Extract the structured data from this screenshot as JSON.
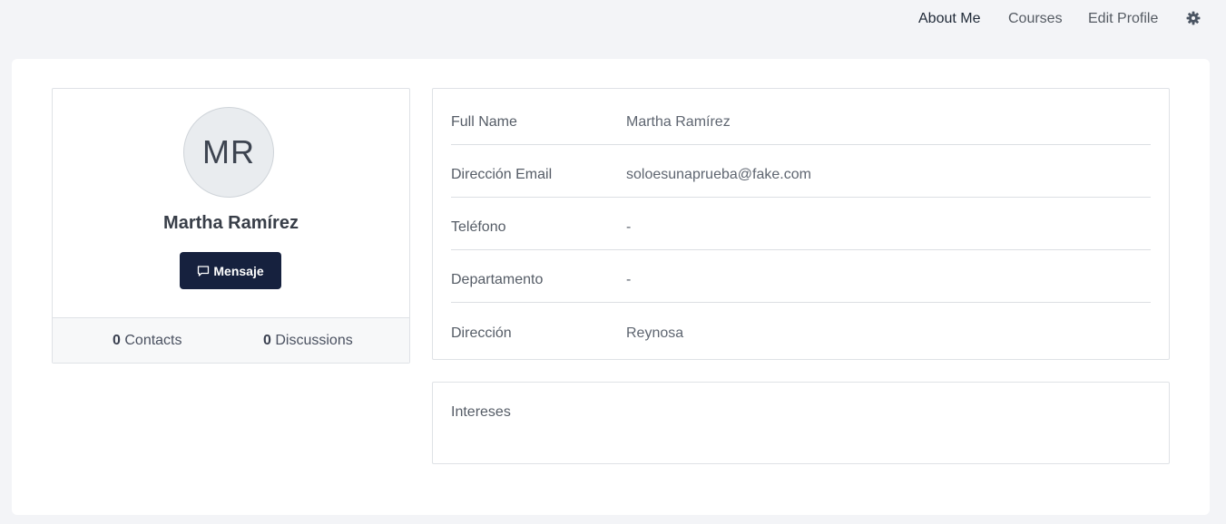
{
  "nav": {
    "about": "About Me",
    "courses": "Courses",
    "edit_profile": "Edit Profile",
    "settings_icon": "gear-icon"
  },
  "profile": {
    "initials": "MR",
    "name": "Martha Ramírez",
    "message_button": "Mensaje",
    "message_icon": "chat-bubble-icon",
    "contacts_count": "0",
    "contacts_label": "Contacts",
    "discussions_count": "0",
    "discussions_label": "Discussions"
  },
  "details": {
    "rows": [
      {
        "label": "Full Name",
        "value": "Martha Ramírez"
      },
      {
        "label": "Dirección Email",
        "value": "soloesunaprueba@fake.com"
      },
      {
        "label": "Teléfono",
        "value": "-"
      },
      {
        "label": "Departamento",
        "value": "-"
      },
      {
        "label": "Dirección",
        "value": "Reynosa"
      }
    ]
  },
  "interests": {
    "label": "Intereses"
  },
  "colors": {
    "accent": "#16213e",
    "background": "#f3f4f7"
  }
}
